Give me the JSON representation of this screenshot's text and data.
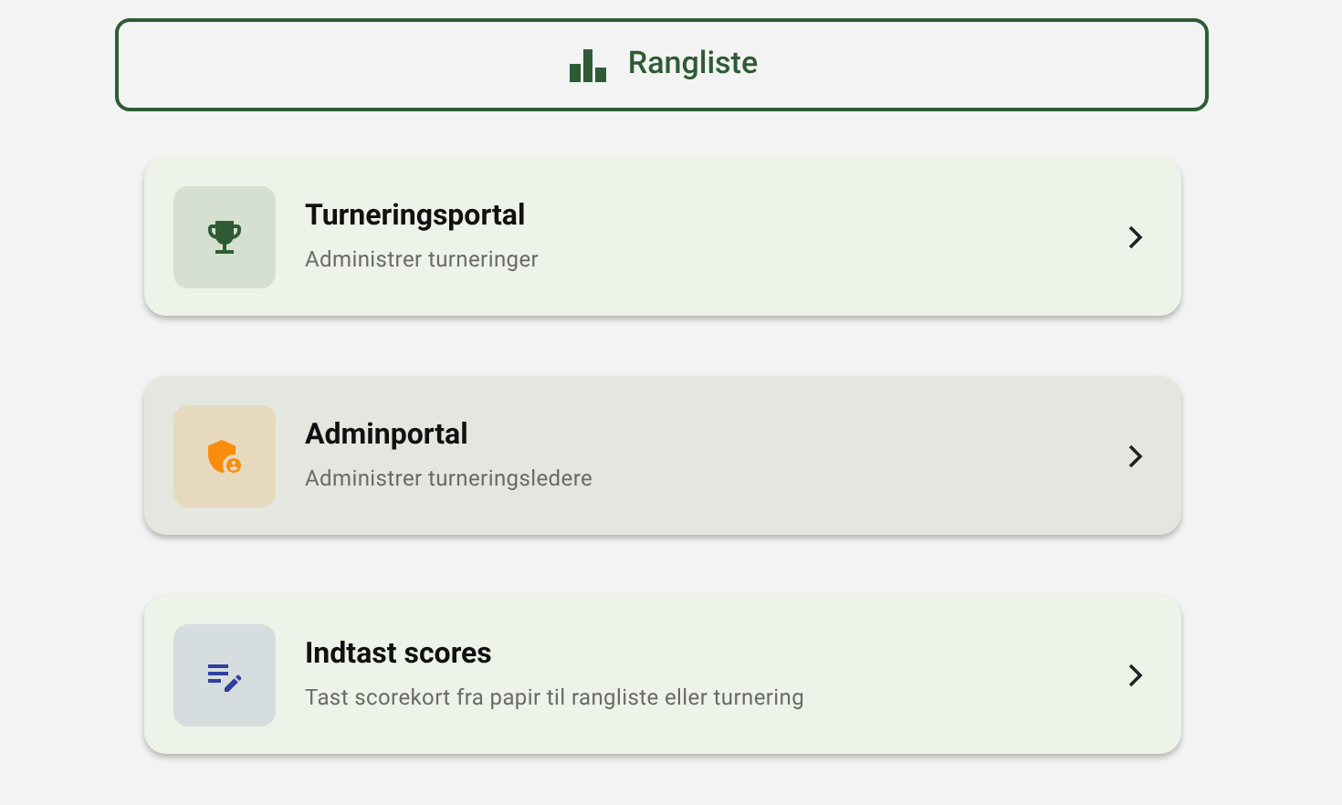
{
  "ranking_button": {
    "label": "Rangliste"
  },
  "cards": [
    {
      "kind": "trophy",
      "title": "Turneringsportal",
      "subtitle": "Administrer turneringer",
      "color": "#2e5b35",
      "selected": false
    },
    {
      "kind": "admin",
      "title": "Adminportal",
      "subtitle": "Administrer turneringsledere",
      "color": "#f98c0a",
      "selected": true
    },
    {
      "kind": "edit",
      "title": "Indtast scores",
      "subtitle": "Tast scorekort fra papir til rangliste eller turnering",
      "color": "#2f3fa0",
      "selected": false
    }
  ]
}
